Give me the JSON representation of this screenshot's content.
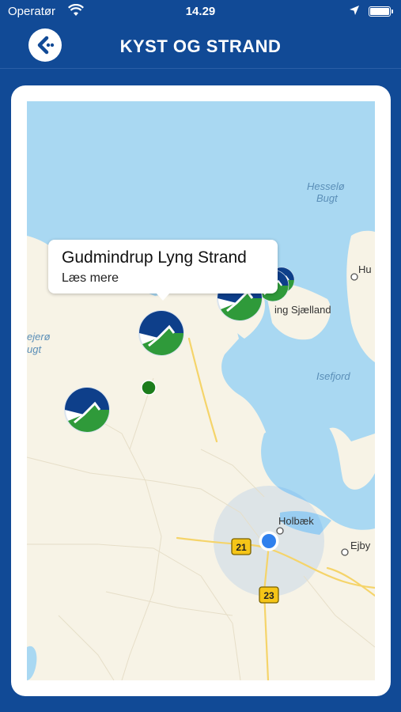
{
  "status_bar": {
    "carrier": "Operatør",
    "time": "14.29"
  },
  "header": {
    "title": "KYST OG STRAND"
  },
  "map": {
    "callout": {
      "title": "Gudmindrup Lyng Strand",
      "subtitle": "Læs mere"
    },
    "water_labels": {
      "hesselo": "Hesselø",
      "bugt": "Bugt",
      "isefjord": "Isefjord",
      "sejero": "ejerø",
      "sejero_bugt": "ugt"
    },
    "town_labels": {
      "holbaek": "Holbæk",
      "ejby": "Ejby",
      "hu": "Hu",
      "sjaelland": "ing Sjælland"
    },
    "road_badges": {
      "road21": "21",
      "road23": "23"
    }
  },
  "colors": {
    "header_bg": "#114a96",
    "water": "#a9d8f2",
    "land": "#f7f3e6",
    "beach_marker_blue": "#0e3f8a",
    "beach_marker_green": "#2f9a3a",
    "user_location": "#2f80ed"
  }
}
